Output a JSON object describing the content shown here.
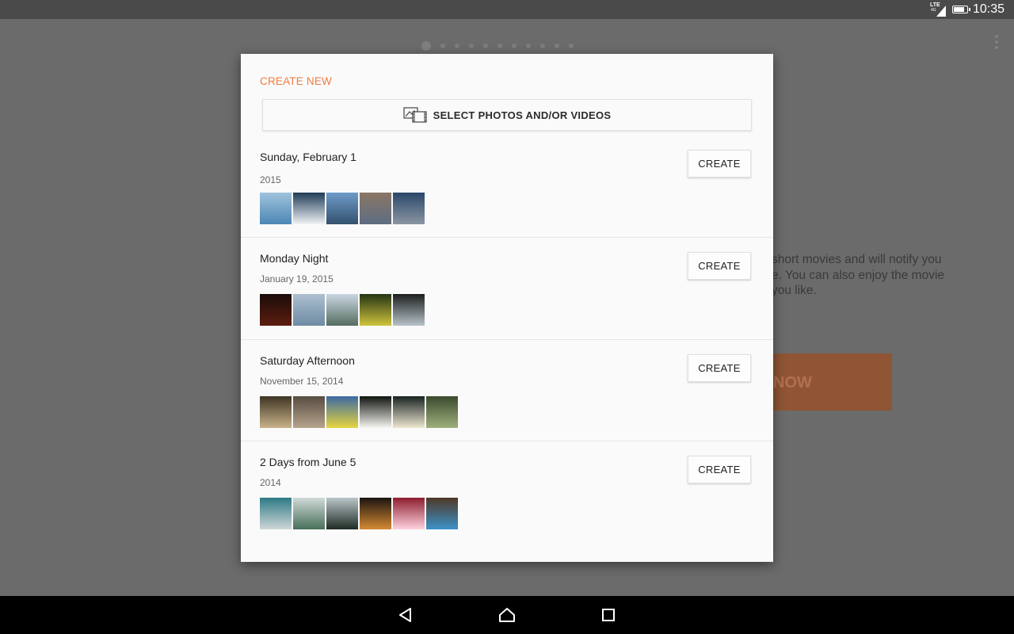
{
  "status_bar": {
    "network": "LTE",
    "network_sub": "4G",
    "battery_level": 0.9,
    "time": "10:35"
  },
  "background": {
    "description": "short movies and will notify you\ne. You can also enjoy the movie\nyou like.",
    "cta_label": "NOW",
    "cta_color": "#8f5534"
  },
  "dialog": {
    "title": "CREATE NEW",
    "accent_color": "#ef7c3f",
    "select_button": {
      "icon": "photo-video-icon",
      "label": "SELECT PHOTOS AND/OR VIDEOS"
    },
    "events": [
      {
        "title": "Sunday, February 1",
        "subtitle": "2015",
        "create_label": "CREATE",
        "thumbnails": [
          [
            "#9fc3dd",
            "#4d86b5"
          ],
          [
            "#1f3b55",
            "#f1f3f6"
          ],
          [
            "#6e9bc8",
            "#34516f"
          ],
          [
            "#8a7665",
            "#5d6d83"
          ],
          [
            "#2a4769",
            "#8b96a2"
          ]
        ]
      },
      {
        "title": "Monday Night",
        "subtitle": "January 19, 2015",
        "create_label": "CREATE",
        "thumbnails": [
          [
            "#1a0c0a",
            "#5d1d0f"
          ],
          [
            "#aebfd0",
            "#6d8ba3"
          ],
          [
            "#c9d6e2",
            "#556d5f"
          ],
          [
            "#243415",
            "#cfc43c"
          ],
          [
            "#1b1e1d",
            "#b7c3c9"
          ]
        ]
      },
      {
        "title": "Saturday Afternoon",
        "subtitle": "November 15, 2014",
        "create_label": "CREATE",
        "thumbnails": [
          [
            "#3e3523",
            "#c9b28a"
          ],
          [
            "#574c41",
            "#b6a48c"
          ],
          [
            "#3d6aa1",
            "#e6d53f"
          ],
          [
            "#10140f",
            "#f6f6f2"
          ],
          [
            "#182321",
            "#efe8d2"
          ],
          [
            "#3b4a2d",
            "#9fb07e"
          ]
        ]
      },
      {
        "title": "2 Days from June 5",
        "subtitle": "2014",
        "create_label": "CREATE",
        "thumbnails": [
          [
            "#2e7a86",
            "#cfd7d8"
          ],
          [
            "#d0dad8",
            "#476f58"
          ],
          [
            "#b9c5c9",
            "#1f2b23"
          ],
          [
            "#1a1410",
            "#d68a33"
          ],
          [
            "#8d1d2f",
            "#ffd2de"
          ],
          [
            "#4e3726",
            "#3d93c8"
          ]
        ]
      }
    ]
  },
  "nav_bar": {
    "back_icon": "back-icon",
    "home_icon": "home-icon",
    "recents_icon": "recents-icon"
  }
}
